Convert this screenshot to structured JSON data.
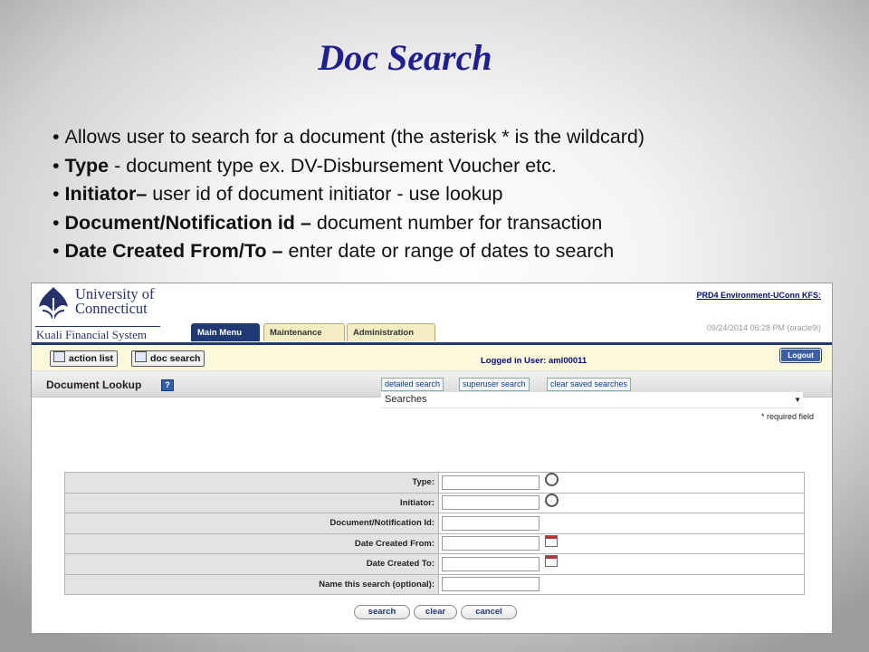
{
  "slide": {
    "title": "Doc Search",
    "bullets": [
      {
        "bold": "",
        "text": "Allows user to search for a document (the asterisk * is the wildcard)"
      },
      {
        "bold": "Type",
        "text": " - document type ex. DV-Disbursement Voucher etc."
      },
      {
        "bold": "Initiator–",
        "text": " user id of document initiator - use lookup"
      },
      {
        "bold": "Document/Notification id –",
        "text": " document number for transaction"
      },
      {
        "bold": "Date Created From/To –",
        "text": " enter date or range of dates to search"
      }
    ]
  },
  "app": {
    "logo_line1": "University of",
    "logo_line2": "Connecticut",
    "logo_sub": "Kuali Financial System",
    "environment": "PRD4 Environment-UConn KFS:",
    "timestamp": "09/24/2014 06:28 PM (oracle9i)",
    "tabs": [
      "Main Menu",
      "Maintenance",
      "Administration"
    ],
    "active_tab": "Main Menu",
    "toolbar": {
      "action_list": "action list",
      "doc_search": "doc search",
      "logged_in": "Logged in User: aml00011",
      "logout": "Logout"
    },
    "lookup": {
      "title": "Document Lookup",
      "help": "?",
      "links": [
        "detailed search",
        "superuser search",
        "clear saved searches"
      ],
      "searches_selected": "Searches",
      "required_note": "* required field"
    },
    "fields": [
      {
        "label": "Type:",
        "value": "",
        "icon": "search-icon"
      },
      {
        "label": "Initiator:",
        "value": "",
        "icon": "search-icon"
      },
      {
        "label": "Document/Notification Id:",
        "value": "",
        "icon": ""
      },
      {
        "label": "Date Created From:",
        "value": "",
        "icon": "calendar-icon"
      },
      {
        "label": "Date Created To:",
        "value": "",
        "icon": "calendar-icon"
      },
      {
        "label": "Name this search (optional):",
        "value": "",
        "icon": ""
      }
    ],
    "buttons": [
      "search",
      "clear",
      "cancel"
    ],
    "colors": {
      "nav_blue": "#1f3a72",
      "title_blue": "#1f1f8f",
      "toolbar_bg": "#fcf8dc"
    }
  }
}
